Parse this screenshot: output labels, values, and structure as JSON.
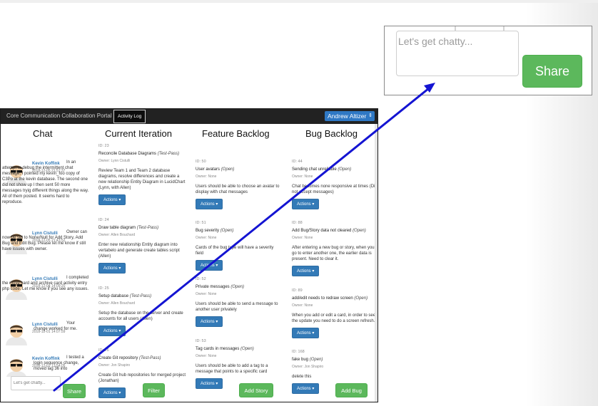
{
  "callout": {
    "placeholder": "Let's get chatty...",
    "share_label": "Share"
  },
  "navbar": {
    "brand": "Core Communication Collaboration Portal",
    "tab": "Activity Log",
    "user": "Andrew Altizer"
  },
  "columns": {
    "chat": "Chat",
    "current": "Current Iteration",
    "feature": "Feature Backlog",
    "bug": "Bug Backlog"
  },
  "chat": {
    "messages": [
      {
        "author": "Kevin Koffink",
        "time": "2018-12-05 21:57:37",
        "text": "In an attempt to debug the intermittent chat message, I pointed my kevin_foo copy of C3Po at the kevin database. The second one did not show up I then sent 50 more messages tryig different things along the way. All of them posted. It seems hard to reproduce."
      },
      {
        "author": "Lynn Cistulli",
        "time": "2018-12-05 21:43:52",
        "text": "Owner can now be set to None/Null for Add Story, Add Bug and Edit Bug. Please let me know if still have issues with owner."
      },
      {
        "author": "Lynn Cistulli",
        "time": "2018-12-04 14:09:20",
        "text": "I completed the move card and archive card activity entry php code. Let me know if you see any issues."
      },
      {
        "author": "Lynn Cistulli",
        "time": "2018-12-01 14:07:59",
        "text": "Your change worked for me."
      },
      {
        "author": "Kevin Koffink",
        "time": "2018-12-01 13:54:05",
        "text": "I tested a login sequence change, moved lag 36 into"
      }
    ],
    "input_placeholder": "Let's get chatty...",
    "share_label": "Share"
  },
  "current": {
    "cards": [
      {
        "id": "ID: 23",
        "title": "Reconcile Database Diagrams",
        "status": "(Test-Pass)",
        "owner": "Owner: Lynn Cistulli",
        "desc": "Review Team 1 and Team 2 database diagrams, resolve differences and create a new relationship Entity Diagram in LucidChart (Lynn, with Allen)",
        "actions": "Actions ▾"
      },
      {
        "id": "ID: 24",
        "title": "Draw table diagram",
        "status": "(Test-Pass)",
        "owner": "Owner: Allen Bouchard",
        "desc": "Enter new relationship Entity diagram into vertabelo and generate create tables script (Allen)",
        "actions": "Actions ▾"
      },
      {
        "id": "ID: 25",
        "title": "Setup database",
        "status": "(Test-Pass)",
        "owner": "Owner: Allen Bouchard",
        "desc": "Setup the database on the server and create accounts for all users (Allen)",
        "actions": "Actions ▾"
      },
      {
        "id": "ID: 26",
        "title": "Create Git repository",
        "status": "(Test-Pass)",
        "owner": "Owner: Jon Shapiro",
        "desc": "Create Git hub repositories for merged project (Jonathan)",
        "actions": "Actions ▾"
      }
    ],
    "filter_label": "Filter"
  },
  "feature": {
    "cards": [
      {
        "id": "ID: 50",
        "title": "User avatars",
        "status": "(Open)",
        "owner": "Owner: None",
        "desc": "Users should be able to choose an avatar to display with chat messages",
        "actions": "Actions ▾"
      },
      {
        "id": "ID: 51",
        "title": "Bug severity",
        "status": "(Open)",
        "owner": "Owner: None",
        "desc": "Cards of the bug type will have a severity field",
        "actions": "Actions ▾"
      },
      {
        "id": "ID: 52",
        "title": "Private messages",
        "status": "(Open)",
        "owner": "Owner: None",
        "desc": "Users should be able to send a message to another user privately",
        "actions": "Actions ▾"
      },
      {
        "id": "ID: 53",
        "title": "Tag cards in messages",
        "status": "(Open)",
        "owner": "Owner: None",
        "desc": "Users should be able to add a tag to a message that points to a specific card",
        "actions": "Actions ▾"
      }
    ],
    "add_label": "Add Story"
  },
  "bug": {
    "cards": [
      {
        "id": "ID: 44",
        "title": "Sending chat unreliable",
        "status": "(Open)",
        "owner": "Owner: None",
        "desc": "Chat becomes none responsive at times (Did not accept messages)",
        "actions": "Actions ▾"
      },
      {
        "id": "ID: 88",
        "title": "Add Bug/Story data not cleared",
        "status": "(Open)",
        "owner": "Owner: None",
        "desc": "After entering a new bug or story, when you go to enter another one, the earlier data is present. Need to clear it.",
        "actions": "Actions ▾"
      },
      {
        "id": "ID: 89",
        "title": "add/edit needs to redraw screen",
        "status": "(Open)",
        "owner": "Owner: None",
        "desc": "When you add or edit a card, in order to see the update you need to do a screen refresh.",
        "actions": "Actions ▾"
      },
      {
        "id": "ID: 168",
        "title": "fake bug",
        "status": "(Open)",
        "owner": "Owner: Jon Shapiro",
        "desc": "delete this",
        "actions": "Actions ▾"
      }
    ],
    "add_label": "Add Bug"
  },
  "colors": {
    "share_green": "#5cb85c",
    "actions_blue": "#337ab7",
    "navbar": "#222222",
    "arrow": "#1414d2"
  }
}
